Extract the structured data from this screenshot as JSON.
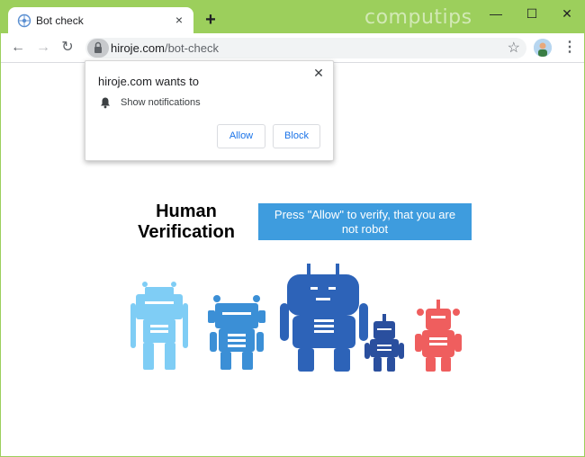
{
  "browser": {
    "tab_title": "Bot check",
    "tab_close": "×",
    "new_tab": "+",
    "watermark": "computips",
    "window_controls": {
      "minimize": "—",
      "maximize": "☐",
      "close": "✕"
    },
    "url_host": "hiroje.com",
    "url_path": "/bot-check",
    "back": "←",
    "forward": "→",
    "reload": "↻",
    "star": "☆",
    "menu": "⋮"
  },
  "popup": {
    "title": "hiroje.com wants to",
    "permission": "Show notifications",
    "close": "✕",
    "allow_label": "Allow",
    "block_label": "Block"
  },
  "page": {
    "heading_line1": "Human",
    "heading_line2": "Verification",
    "instruction_line1": "Press \"Allow\" to verify, that you are",
    "instruction_line2": "not robot"
  },
  "colors": {
    "frame": "#9ccf5c",
    "accent_blue": "#3e9cde",
    "link_blue": "#1a73e8",
    "robot_light_blue": "#7fcdf5",
    "robot_mid_blue": "#3b8fd6",
    "robot_dark_blue": "#2d63b8",
    "robot_navy": "#2a4f9e",
    "robot_red": "#ef5e5e"
  },
  "icons": [
    "tab-favicon-icon",
    "lock-icon",
    "star-icon",
    "bell-icon",
    "close-icon",
    "avatar"
  ]
}
